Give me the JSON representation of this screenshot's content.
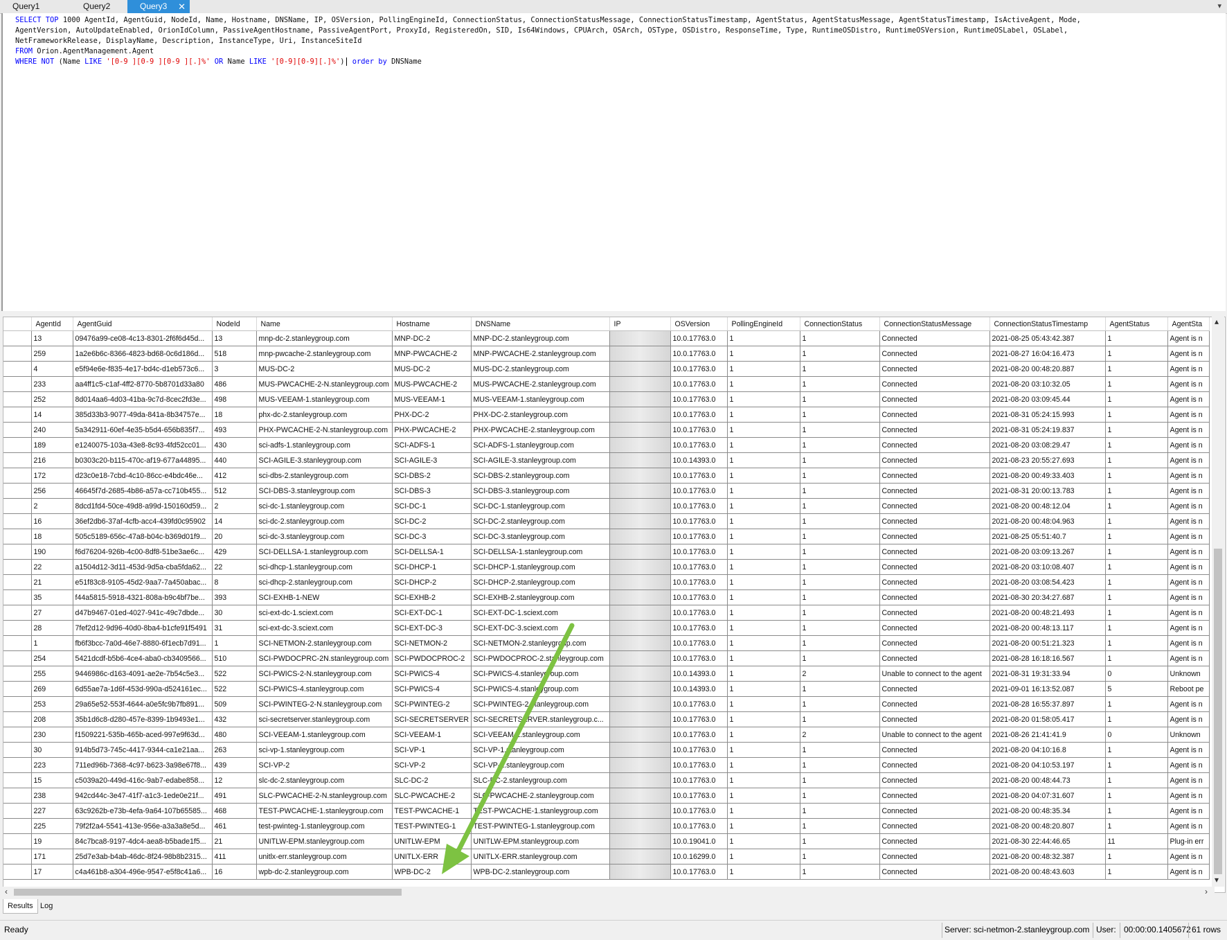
{
  "tabs": [
    "Query1",
    "Query2",
    "Query3"
  ],
  "active_tab": 2,
  "tab_close_glyph": "✕",
  "sql": {
    "line1_kw": "SELECT TOP",
    "line1_rest": " 1000 AgentId, AgentGuid, NodeId, Name, Hostname, DNSName, IP, OSVersion, PollingEngineId, ConnectionStatus, ConnectionStatusMessage, ConnectionStatusTimestamp, AgentStatus, AgentStatusMessage, AgentStatusTimestamp, IsActiveAgent, Mode,",
    "line2": "AgentVersion, AutoUpdateEnabled, OrionIdColumn, PassiveAgentHostname, PassiveAgentPort, ProxyId, RegisteredOn, SID, Is64Windows, CPUArch, OSArch, OSType, OSDistro, ResponseTime, Type, RuntimeOSDistro, RuntimeOSVersion, RuntimeOSLabel, OSLabel,",
    "line3": "NetFrameworkRelease, DisplayName, Description, InstanceType, Uri, InstanceSiteId",
    "line4_kw": "FROM",
    "line4_rest": " Orion.AgentManagement.Agent",
    "line5_where": "WHERE NOT",
    "line5_a": " (Name ",
    "line5_like1": "LIKE",
    "line5_str1": " '[0-9 ][0-9 ][0-9 ][.]%'",
    "line5_or": " OR",
    "line5_b": " Name ",
    "line5_like2": "LIKE",
    "line5_str2": " '[0-9][0-9][.]%'",
    "line5_c": ")",
    "line5_order": " order by",
    "line5_d": " DNSName"
  },
  "columns": [
    "AgentId",
    "AgentGuid",
    "NodeId",
    "Name",
    "Hostname",
    "DNSName",
    "IP",
    "OSVersion",
    "PollingEngineId",
    "ConnectionStatus",
    "ConnectionStatusMessage",
    "ConnectionStatusTimestamp",
    "AgentStatus",
    "AgentSta"
  ],
  "rows": [
    [
      "13",
      "09476a99-ce08-4c13-8301-2f6f6d45d...",
      "13",
      "mnp-dc-2.stanleygroup.com",
      "MNP-DC-2",
      "MNP-DC-2.stanleygroup.com",
      "",
      "10.0.17763.0",
      "1",
      "1",
      "Connected",
      "2021-08-25 05:43:42.387",
      "1",
      "Agent is n"
    ],
    [
      "259",
      "1a2e6b6c-8366-4823-bd68-0c6d186d...",
      "518",
      "mnp-pwcache-2.stanleygroup.com",
      "MNP-PWCACHE-2",
      "MNP-PWCACHE-2.stanleygroup.com",
      "",
      "10.0.17763.0",
      "1",
      "1",
      "Connected",
      "2021-08-27 16:04:16.473",
      "1",
      "Agent is n"
    ],
    [
      "4",
      "e5f94e6e-f835-4e17-bd4c-d1eb573c6...",
      "3",
      "MUS-DC-2",
      "MUS-DC-2",
      "MUS-DC-2.stanleygroup.com",
      "",
      "10.0.17763.0",
      "1",
      "1",
      "Connected",
      "2021-08-20 00:48:20.887",
      "1",
      "Agent is n"
    ],
    [
      "233",
      "aa4ff1c5-c1af-4ff2-8770-5b8701d33a80",
      "486",
      "MUS-PWCACHE-2-N.stanleygroup.com",
      "MUS-PWCACHE-2",
      "MUS-PWCACHE-2.stanleygroup.com",
      "",
      "10.0.17763.0",
      "1",
      "1",
      "Connected",
      "2021-08-20 03:10:32.05",
      "1",
      "Agent is n"
    ],
    [
      "252",
      "8d014aa6-4d03-41ba-9c7d-8cec2fd3e...",
      "498",
      "MUS-VEEAM-1.stanleygroup.com",
      "MUS-VEEAM-1",
      "MUS-VEEAM-1.stanleygroup.com",
      "",
      "10.0.17763.0",
      "1",
      "1",
      "Connected",
      "2021-08-20 03:09:45.44",
      "1",
      "Agent is n"
    ],
    [
      "14",
      "385d33b3-9077-49da-841a-8b34757e...",
      "18",
      "phx-dc-2.stanleygroup.com",
      "PHX-DC-2",
      "PHX-DC-2.stanleygroup.com",
      "",
      "10.0.17763.0",
      "1",
      "1",
      "Connected",
      "2021-08-31 05:24:15.993",
      "1",
      "Agent is n"
    ],
    [
      "240",
      "5a342911-60ef-4e35-b5d4-656b835f7...",
      "493",
      "PHX-PWCACHE-2-N.stanleygroup.com",
      "PHX-PWCACHE-2",
      "PHX-PWCACHE-2.stanleygroup.com",
      "",
      "10.0.17763.0",
      "1",
      "1",
      "Connected",
      "2021-08-31 05:24:19.837",
      "1",
      "Agent is n"
    ],
    [
      "189",
      "e1240075-103a-43e8-8c93-4fd52cc01...",
      "430",
      "sci-adfs-1.stanleygroup.com",
      "SCI-ADFS-1",
      "SCI-ADFS-1.stanleygroup.com",
      "",
      "10.0.17763.0",
      "1",
      "1",
      "Connected",
      "2021-08-20 03:08:29.47",
      "1",
      "Agent is n"
    ],
    [
      "216",
      "b0303c20-b115-470c-af19-677a44895...",
      "440",
      "SCI-AGILE-3.stanleygroup.com",
      "SCI-AGILE-3",
      "SCI-AGILE-3.stanleygroup.com",
      "",
      "10.0.14393.0",
      "1",
      "1",
      "Connected",
      "2021-08-23 20:55:27.693",
      "1",
      "Agent is n"
    ],
    [
      "172",
      "d23c0e18-7cbd-4c10-86cc-e4bdc46e...",
      "412",
      "sci-dbs-2.stanleygroup.com",
      "SCI-DBS-2",
      "SCI-DBS-2.stanleygroup.com",
      "",
      "10.0.17763.0",
      "1",
      "1",
      "Connected",
      "2021-08-20 00:49:33.403",
      "1",
      "Agent is n"
    ],
    [
      "256",
      "46645f7d-2685-4b86-a57a-cc710b455...",
      "512",
      "SCI-DBS-3.stanleygroup.com",
      "SCI-DBS-3",
      "SCI-DBS-3.stanleygroup.com",
      "",
      "10.0.17763.0",
      "1",
      "1",
      "Connected",
      "2021-08-31 20:00:13.783",
      "1",
      "Agent is n"
    ],
    [
      "2",
      "8dcd1fd4-50ce-49d8-a99d-150160d59...",
      "2",
      "sci-dc-1.stanleygroup.com",
      "SCI-DC-1",
      "SCI-DC-1.stanleygroup.com",
      "",
      "10.0.17763.0",
      "1",
      "1",
      "Connected",
      "2021-08-20 00:48:12.04",
      "1",
      "Agent is n"
    ],
    [
      "16",
      "36ef2db6-37af-4cfb-acc4-439fd0c95902",
      "14",
      "sci-dc-2.stanleygroup.com",
      "SCI-DC-2",
      "SCI-DC-2.stanleygroup.com",
      "",
      "10.0.17763.0",
      "1",
      "1",
      "Connected",
      "2021-08-20 00:48:04.963",
      "1",
      "Agent is n"
    ],
    [
      "18",
      "505c5189-656c-47a8-b04c-b369d01f9...",
      "20",
      "sci-dc-3.stanleygroup.com",
      "SCI-DC-3",
      "SCI-DC-3.stanleygroup.com",
      "",
      "10.0.17763.0",
      "1",
      "1",
      "Connected",
      "2021-08-25 05:51:40.7",
      "1",
      "Agent is n"
    ],
    [
      "190",
      "f6d76204-926b-4c00-8df8-51be3ae6c...",
      "429",
      "SCI-DELLSA-1.stanleygroup.com",
      "SCI-DELLSA-1",
      "SCI-DELLSA-1.stanleygroup.com",
      "",
      "10.0.17763.0",
      "1",
      "1",
      "Connected",
      "2021-08-20 03:09:13.267",
      "1",
      "Agent is n"
    ],
    [
      "22",
      "a1504d12-3d11-453d-9d5a-cba5fda62...",
      "22",
      "sci-dhcp-1.stanleygroup.com",
      "SCI-DHCP-1",
      "SCI-DHCP-1.stanleygroup.com",
      "",
      "10.0.17763.0",
      "1",
      "1",
      "Connected",
      "2021-08-20 03:10:08.407",
      "1",
      "Agent is n"
    ],
    [
      "21",
      "e51f83c8-9105-45d2-9aa7-7a450abac...",
      "8",
      "sci-dhcp-2.stanleygroup.com",
      "SCI-DHCP-2",
      "SCI-DHCP-2.stanleygroup.com",
      "",
      "10.0.17763.0",
      "1",
      "1",
      "Connected",
      "2021-08-20 03:08:54.423",
      "1",
      "Agent is n"
    ],
    [
      "35",
      "f44a5815-5918-4321-808a-b9c4bf7be...",
      "393",
      "SCI-EXHB-1-NEW",
      "SCI-EXHB-2",
      "SCI-EXHB-2.stanleygroup.com",
      "",
      "10.0.17763.0",
      "1",
      "1",
      "Connected",
      "2021-08-30 20:34:27.687",
      "1",
      "Agent is n"
    ],
    [
      "27",
      "d47b9467-01ed-4027-941c-49c7dbde...",
      "30",
      "sci-ext-dc-1.sciext.com",
      "SCI-EXT-DC-1",
      "SCI-EXT-DC-1.sciext.com",
      "",
      "10.0.17763.0",
      "1",
      "1",
      "Connected",
      "2021-08-20 00:48:21.493",
      "1",
      "Agent is n"
    ],
    [
      "28",
      "7fef2d12-9d96-40d0-8ba4-b1cfe91f5491",
      "31",
      "sci-ext-dc-3.sciext.com",
      "SCI-EXT-DC-3",
      "SCI-EXT-DC-3.sciext.com",
      "",
      "10.0.17763.0",
      "1",
      "1",
      "Connected",
      "2021-08-20 00:48:13.117",
      "1",
      "Agent is n"
    ],
    [
      "1",
      "fb6f3bcc-7a0d-46e7-8880-6f1ecb7d91...",
      "1",
      "SCI-NETMON-2.stanleygroup.com",
      "SCI-NETMON-2",
      "SCI-NETMON-2.stanleygroup.com",
      "",
      "10.0.17763.0",
      "1",
      "1",
      "Connected",
      "2021-08-20 00:51:21.323",
      "1",
      "Agent is n"
    ],
    [
      "254",
      "5421dcdf-b5b6-4ce4-aba0-cb3409566...",
      "510",
      "SCI-PWDOCPRC-2N.stanleygroup.com",
      "SCI-PWDOCPROC-2",
      "SCI-PWDOCPROC-2.stanleygroup.com",
      "",
      "10.0.17763.0",
      "1",
      "1",
      "Connected",
      "2021-08-28 16:18:16.567",
      "1",
      "Agent is n"
    ],
    [
      "255",
      "9446986c-d163-4091-ae2e-7b54c5e3...",
      "522",
      "SCI-PWICS-2-N.stanleygroup.com",
      "SCI-PWICS-4",
      "SCI-PWICS-4.stanleygroup.com",
      "",
      "10.0.14393.0",
      "1",
      "2",
      "Unable to connect to the agent",
      "2021-08-31 19:31:33.94",
      "0",
      "Unknown"
    ],
    [
      "269",
      "6d55ae7a-1d6f-453d-990a-d524161ec...",
      "522",
      "SCI-PWICS-4.stanleygroup.com",
      "SCI-PWICS-4",
      "SCI-PWICS-4.stanleygroup.com",
      "",
      "10.0.14393.0",
      "1",
      "1",
      "Connected",
      "2021-09-01 16:13:52.087",
      "5",
      "Reboot pe"
    ],
    [
      "253",
      "29a65e52-553f-4644-a0e5fc9b7fb891...",
      "509",
      "SCI-PWINTEG-2-N.stanleygroup.com",
      "SCI-PWINTEG-2",
      "SCI-PWINTEG-2.stanleygroup.com",
      "",
      "10.0.17763.0",
      "1",
      "1",
      "Connected",
      "2021-08-28 16:55:37.897",
      "1",
      "Agent is n"
    ],
    [
      "208",
      "35b1d6c8-d280-457e-8399-1b9493e1...",
      "432",
      "sci-secretserver.stanleygroup.com",
      "SCI-SECRETSERVER",
      "SCI-SECRETSERVER.stanleygroup.c...",
      "",
      "10.0.17763.0",
      "1",
      "1",
      "Connected",
      "2021-08-20 01:58:05.417",
      "1",
      "Agent is n"
    ],
    [
      "230",
      "f1509221-535b-465b-aced-997e9f63d...",
      "480",
      "SCI-VEEAM-1.stanleygroup.com",
      "SCI-VEEAM-1",
      "SCI-VEEAM-1.stanleygroup.com",
      "",
      "10.0.17763.0",
      "1",
      "2",
      "Unable to connect to the agent",
      "2021-08-26 21:41:41.9",
      "0",
      "Unknown"
    ],
    [
      "30",
      "914b5d73-745c-4417-9344-ca1e21aa...",
      "263",
      "sci-vp-1.stanleygroup.com",
      "SCI-VP-1",
      "SCI-VP-1.stanleygroup.com",
      "",
      "10.0.17763.0",
      "1",
      "1",
      "Connected",
      "2021-08-20 04:10:16.8",
      "1",
      "Agent is n"
    ],
    [
      "223",
      "711ed96b-7368-4c97-b623-3a98e67f8...",
      "439",
      "SCI-VP-2",
      "SCI-VP-2",
      "SCI-VP-2.stanleygroup.com",
      "",
      "10.0.17763.0",
      "1",
      "1",
      "Connected",
      "2021-08-20 04:10:53.197",
      "1",
      "Agent is n"
    ],
    [
      "15",
      "c5039a20-449d-416c-9ab7-edabe858...",
      "12",
      "slc-dc-2.stanleygroup.com",
      "SLC-DC-2",
      "SLC-DC-2.stanleygroup.com",
      "",
      "10.0.17763.0",
      "1",
      "1",
      "Connected",
      "2021-08-20 00:48:44.73",
      "1",
      "Agent is n"
    ],
    [
      "238",
      "942cd44c-3e47-41f7-a1c3-1ede0e21f...",
      "491",
      "SLC-PWCACHE-2-N.stanleygroup.com",
      "SLC-PWCACHE-2",
      "SLC-PWCACHE-2.stanleygroup.com",
      "",
      "10.0.17763.0",
      "1",
      "1",
      "Connected",
      "2021-08-20 04:07:31.607",
      "1",
      "Agent is n"
    ],
    [
      "227",
      "63c9262b-e73b-4efa-9a64-107b65585...",
      "468",
      "TEST-PWCACHE-1.stanleygroup.com",
      "TEST-PWCACHE-1",
      "TEST-PWCACHE-1.stanleygroup.com",
      "",
      "10.0.17763.0",
      "1",
      "1",
      "Connected",
      "2021-08-20 00:48:35.34",
      "1",
      "Agent is n"
    ],
    [
      "225",
      "79f2f2a4-5541-413e-956e-a3a3a8e5d...",
      "461",
      "test-pwinteg-1.stanleygroup.com",
      "TEST-PWINTEG-1",
      "TEST-PWINTEG-1.stanleygroup.com",
      "",
      "10.0.17763.0",
      "1",
      "1",
      "Connected",
      "2021-08-20 00:48:20.807",
      "1",
      "Agent is n"
    ],
    [
      "19",
      "84c7bca8-9197-4dc4-aea8-b5bade1f5...",
      "21",
      "UNITLW-EPM.stanleygroup.com",
      "UNITLW-EPM",
      "UNITLW-EPM.stanleygroup.com",
      "",
      "10.0.19041.0",
      "1",
      "1",
      "Connected",
      "2021-08-30 22:44:46.65",
      "11",
      "Plug-in err"
    ],
    [
      "171",
      "25d7e3ab-b4ab-46dc-8f24-98b8b2315...",
      "411",
      "unitlx-err.stanleygroup.com",
      "UNITLX-ERR",
      "UNITLX-ERR.stanleygroup.com",
      "",
      "10.0.16299.0",
      "1",
      "1",
      "Connected",
      "2021-08-20 00:48:32.387",
      "1",
      "Agent is n"
    ],
    [
      "17",
      "c4a461b8-a304-496e-9547-e5f8c41a6...",
      "16",
      "wpb-dc-2.stanleygroup.com",
      "WPB-DC-2",
      "WPB-DC-2.stanleygroup.com",
      "",
      "10.0.17763.0",
      "1",
      "1",
      "Connected",
      "2021-08-20 00:48:43.603",
      "1",
      "Agent is n"
    ]
  ],
  "bottom_tabs": [
    "Results",
    "Log"
  ],
  "status": {
    "state": "Ready",
    "server": "Server: sci-netmon-2.stanleygroup.com",
    "user": "User:",
    "elapsed": "00:00:00.1405672",
    "rows": "61 rows"
  },
  "annotation_color": "#7dc242"
}
